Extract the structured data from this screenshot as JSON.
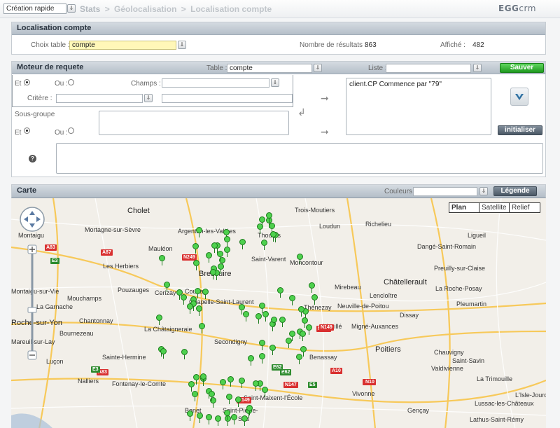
{
  "topbar": {
    "quick_create": "Création rapide",
    "breadcrumb": [
      "Stats",
      ">",
      "Géolocalisation",
      ">",
      "Localisation compte"
    ],
    "logo_prefix": "EGG",
    "logo_suffix": "crm"
  },
  "localisation": {
    "title": "Localisation compte",
    "choice_label": "Choix table :",
    "choice_value": "compte",
    "results_label": "Nombre de résultats :",
    "results_value": "863",
    "shown_label": "Affiché :",
    "shown_value": "482"
  },
  "moteur": {
    "title": "Moteur de requete",
    "table_label": "Table :",
    "table_value": "compte",
    "liste_label": "Liste :",
    "save_label": "Sauver",
    "et_label": "Et :",
    "ou_label": "Ou :",
    "champs_label": "Champs :",
    "critere_label": "Critère :",
    "sousgroupe_label": "Sous-groupe",
    "et2_label": "Et",
    "ou2_label": "Ou :",
    "query_text": "client.CP Commence par \"79\"",
    "init_label": "initialiser",
    "help_icon": "question-icon"
  },
  "carte": {
    "title": "Carte",
    "couleurs_label": "Couleurs :",
    "legend_label": "Légende",
    "map_types": [
      "Plan",
      "Satellite",
      "Relief"
    ],
    "places": [
      {
        "name": "Cholet",
        "big": true
      },
      {
        "name": "Montaigu",
        "big": false
      },
      {
        "name": "Mortagne-sur-Sèvre",
        "big": false
      },
      {
        "name": "Argenton-les-Vallées",
        "big": false
      },
      {
        "name": "Trois-Moutiers",
        "big": false
      },
      {
        "name": "Loudun",
        "big": false
      },
      {
        "name": "Richelieu",
        "big": false
      },
      {
        "name": "Thouars",
        "big": false
      },
      {
        "name": "Ligueil",
        "big": false
      },
      {
        "name": "Mauléon",
        "big": false
      },
      {
        "name": "Les Herbiers",
        "big": false
      },
      {
        "name": "Bressuire",
        "big": true
      },
      {
        "name": "Saint-Varent",
        "big": false
      },
      {
        "name": "Moncontour",
        "big": false
      },
      {
        "name": "Dangé-Saint-Romain",
        "big": false
      },
      {
        "name": "Preuilly-sur-Claise",
        "big": false
      },
      {
        "name": "Châtellerault",
        "big": true
      },
      {
        "name": "La Roche-Posay",
        "big": false
      },
      {
        "name": "Montaigu-sur-Vie",
        "big": false
      },
      {
        "name": "Mouchamps",
        "big": false
      },
      {
        "name": "Pouzauges",
        "big": false
      },
      {
        "name": "Cerizay",
        "big": false
      },
      {
        "name": "Mirebeau",
        "big": false
      },
      {
        "name": "Lencloître",
        "big": false
      },
      {
        "name": "La Garnache",
        "big": false
      },
      {
        "name": "Courlay",
        "big": false
      },
      {
        "name": "Chapelle-Saint-Laurent",
        "big": false
      },
      {
        "name": "Thénezay",
        "big": false
      },
      {
        "name": "Neuville-de-Poitou",
        "big": false
      },
      {
        "name": "Pleumartin",
        "big": false
      },
      {
        "name": "Roche-sur-Yon",
        "big": true
      },
      {
        "name": "Chantonnay",
        "big": false
      },
      {
        "name": "Dissay",
        "big": false
      },
      {
        "name": "Bournezeau",
        "big": false
      },
      {
        "name": "La Châtaigneraie",
        "big": false
      },
      {
        "name": "Vouillé",
        "big": false
      },
      {
        "name": "Migné-Auxances",
        "big": false
      },
      {
        "name": "Poitiers",
        "big": true
      },
      {
        "name": "Secondigny",
        "big": false
      },
      {
        "name": "Chauvigny",
        "big": false
      },
      {
        "name": "Mareuil-sur-Lay",
        "big": false
      },
      {
        "name": "Sainte-Hermine",
        "big": false
      },
      {
        "name": "Benassay",
        "big": false
      },
      {
        "name": "Saint-Savin",
        "big": false
      },
      {
        "name": "Luçon",
        "big": false
      },
      {
        "name": "Nalliers",
        "big": false
      },
      {
        "name": "Fontenay-le-Comte",
        "big": false
      },
      {
        "name": "Vivonne",
        "big": false
      },
      {
        "name": "Valdivienne",
        "big": false
      },
      {
        "name": "La Trimouille",
        "big": false
      },
      {
        "name": "Saint-Maixent-l'École",
        "big": false
      },
      {
        "name": "Gençay",
        "big": false
      },
      {
        "name": "Lussac-les-Châteaux",
        "big": false
      },
      {
        "name": "Benet",
        "big": false
      },
      {
        "name": "Saint-Pierre-",
        "big": false
      },
      {
        "name": "L'Isle-Jourdain",
        "big": false
      },
      {
        "name": "Lathus-Saint-Rémy",
        "big": false
      },
      {
        "name": "Sou",
        "big": false
      }
    ],
    "road_shields": [
      "A83",
      "A87",
      "E3",
      "N249",
      "A83",
      "E3",
      "N149",
      "N10",
      "E62",
      "A10",
      "N149",
      "E62",
      "N10",
      "N147",
      "A83",
      "E3",
      "E5",
      "N149"
    ],
    "marker_count": 482
  },
  "colors": {
    "accent_green": "#2ea52e",
    "header_blue": "#b5bfc9",
    "input_yellow": "#fff7b8",
    "marker_green": "#4ed14e"
  }
}
